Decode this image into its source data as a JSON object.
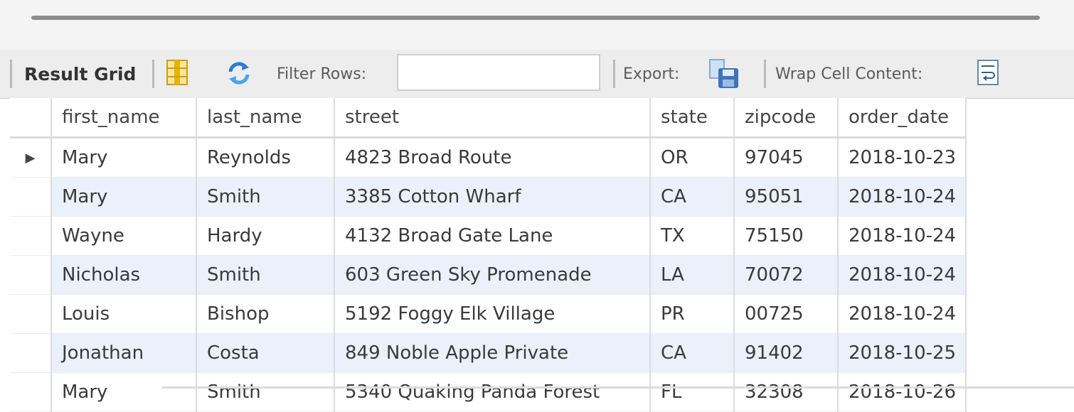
{
  "toolbar": {
    "result_grid_label": "Result Grid",
    "filter_label": "Filter Rows:",
    "filter_value": "",
    "export_label": "Export:",
    "wrap_label": "Wrap Cell Content:",
    "icons": [
      "grid-layout-icon",
      "refresh-icon",
      "export-save-icon",
      "wrap-text-icon"
    ],
    "accent_colors": {
      "grid_icon": "#e8b400",
      "refresh_icon": "#2e7bd1",
      "export_icon": "#3f74b8"
    }
  },
  "table": {
    "columns": [
      "first_name",
      "last_name",
      "street",
      "state",
      "zipcode",
      "order_date"
    ],
    "current_row_marker": "▶",
    "rows": [
      [
        "Mary",
        "Reynolds",
        "4823 Broad Route",
        "OR",
        "97045",
        "2018-10-23"
      ],
      [
        "Mary",
        "Smith",
        "3385 Cotton Wharf",
        "CA",
        "95051",
        "2018-10-24"
      ],
      [
        "Wayne",
        "Hardy",
        "4132 Broad Gate Lane",
        "TX",
        "75150",
        "2018-10-24"
      ],
      [
        "Nicholas",
        "Smith",
        "603 Green Sky Promenade",
        "LA",
        "70072",
        "2018-10-24"
      ],
      [
        "Louis",
        "Bishop",
        "5192 Foggy Elk Village",
        "PR",
        "00725",
        "2018-10-24"
      ],
      [
        "Jonathan",
        "Costa",
        "849 Noble Apple Private",
        "CA",
        "91402",
        "2018-10-25"
      ],
      [
        "Mary",
        "Smith",
        "5340 Quaking Panda Forest",
        "FL",
        "32308",
        "2018-10-26"
      ]
    ],
    "alt_row_color": "#eaf1fb"
  }
}
